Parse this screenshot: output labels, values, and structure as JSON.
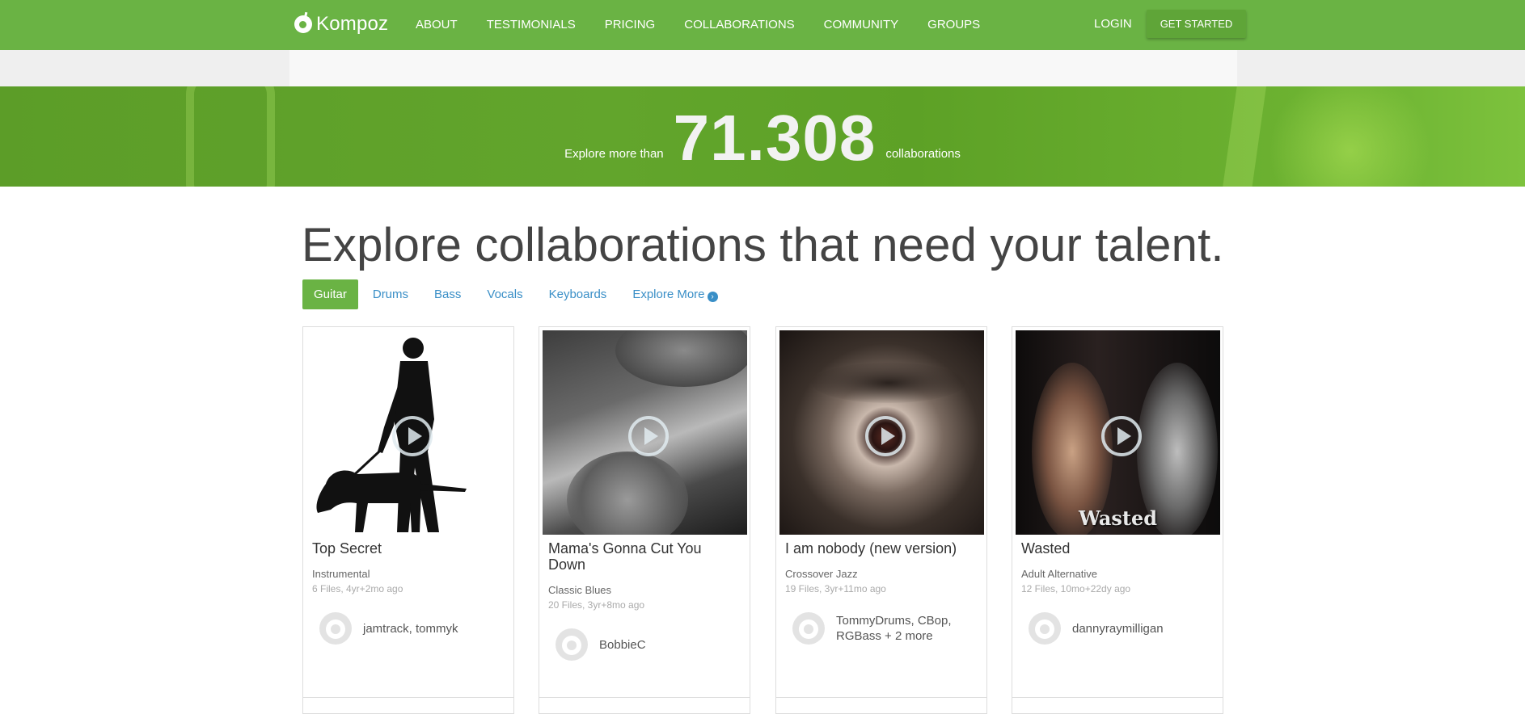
{
  "nav": {
    "logo": "Kompoz",
    "links": [
      "ABOUT",
      "TESTIMONIALS",
      "PRICING",
      "COLLABORATIONS",
      "COMMUNITY",
      "GROUPS"
    ],
    "login": "LOGIN",
    "cta": "GET STARTED"
  },
  "banner": {
    "prefix": "Explore more than",
    "count": "71.308",
    "suffix": "collaborations"
  },
  "headline": "Explore collaborations that need your talent.",
  "tabs": {
    "items": [
      "Guitar",
      "Drums",
      "Bass",
      "Vocals",
      "Keyboards"
    ],
    "active": "Guitar",
    "more": "Explore More"
  },
  "cards": [
    {
      "title": "Top Secret",
      "genre": "Instrumental",
      "meta": "6 Files, 4yr+2mo ago",
      "users": "jamtrack, tommyk",
      "art": "silhouette-man-with-guide-dog"
    },
    {
      "title": "Mama's Gonna Cut You Down",
      "genre": "Classic Blues",
      "meta": "20 Files, 3yr+8mo ago",
      "users": "BobbieC",
      "art": "man-playing-acoustic-guitar"
    },
    {
      "title": "I am nobody (new version)",
      "genre": "Crossover Jazz",
      "meta": "19 Files, 3yr+11mo ago",
      "users": "TommyDrums, CBop, RGBass + 2 more",
      "art": "close-up-eye"
    },
    {
      "title": "Wasted",
      "genre": "Adult Alternative",
      "meta": "12 Files, 10mo+22dy ago",
      "users": "dannyraymilligan",
      "art": "woman-at-mirror",
      "art_caption": "Wasted"
    }
  ],
  "colors": {
    "brand_green": "#6ab344",
    "link_blue": "#3a8fc7",
    "headline": "#444444"
  }
}
